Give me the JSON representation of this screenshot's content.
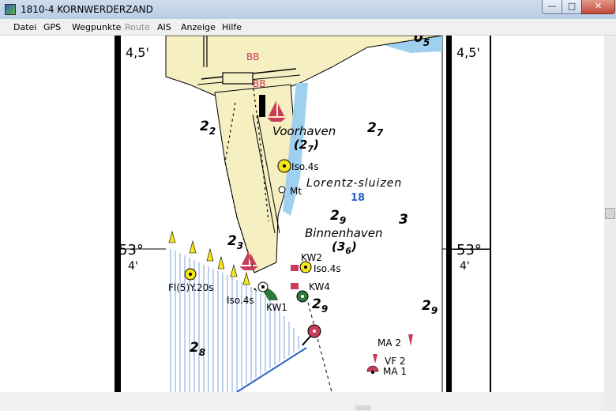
{
  "window": {
    "title": "1810-4 KORNWERDERZAND",
    "minimize_glyph": "—",
    "maximize_glyph": "□",
    "close_glyph": "✕"
  },
  "menu": {
    "items": [
      {
        "label": "Datei",
        "enabled": true
      },
      {
        "label": "GPS",
        "enabled": true
      },
      {
        "label": "Wegpunkte",
        "enabled": true
      },
      {
        "label": "Route",
        "enabled": false
      },
      {
        "label": "AIS",
        "enabled": true
      },
      {
        "label": "Anzeige",
        "enabled": true
      },
      {
        "label": "Hilfe",
        "enabled": true
      }
    ]
  },
  "chart": {
    "lat_top_left": "4,5'",
    "lat_top_right": "4,5'",
    "lat_mid_left_deg": "53°",
    "lat_mid_left_min": "4'",
    "lat_mid_right_deg": "53°",
    "lat_mid_right_min": "4'",
    "name_voorhaven": "Voorhaven",
    "name_lorentz": "Lorentz-sluizen",
    "name_binnenhaven": "Binnenhaven",
    "lorentz_number": "18",
    "bb_upper": "BB",
    "bb_lower": "BB",
    "light_iso_upper": "Iso.4s",
    "light_iso_right": "Iso.4s",
    "light_iso_lower": "Iso.4s",
    "light_fl": "Fl(5)Y.20s",
    "mt_label": "Mt",
    "kw1": "KW1",
    "kw2": "KW2",
    "kw4": "KW4",
    "ma2": "MA 2",
    "ma1": "MA 1",
    "vf2": "VF 2",
    "depths": [
      {
        "main": "2",
        "sub": "2"
      },
      {
        "main": "2",
        "sub": "7"
      },
      {
        "main": "(2",
        "sub": "7",
        "close": ")"
      },
      {
        "main": "2",
        "sub": "9"
      },
      {
        "main": "3",
        "sub": ""
      },
      {
        "main": "(3",
        "sub": "6",
        "close": ")"
      },
      {
        "main": "2",
        "sub": "3"
      },
      {
        "main": "2",
        "sub": "9"
      },
      {
        "main": "2",
        "sub": "9"
      },
      {
        "main": "2",
        "sub": "8"
      },
      {
        "main": "0",
        "sub": "5"
      }
    ],
    "colors": {
      "land": "#f5efc2",
      "water": "#ffffff",
      "shallow": "#cfe4f5",
      "deep_blue": "#9fd0f0",
      "magenta": "#c83c5a",
      "light_yellow": "#f6e619",
      "buoy_green": "#2d7a3a",
      "link_blue": "#2a63c8"
    }
  },
  "scrollbar": {
    "vertical_position": 0.47,
    "horizontal_position": 0.6
  }
}
